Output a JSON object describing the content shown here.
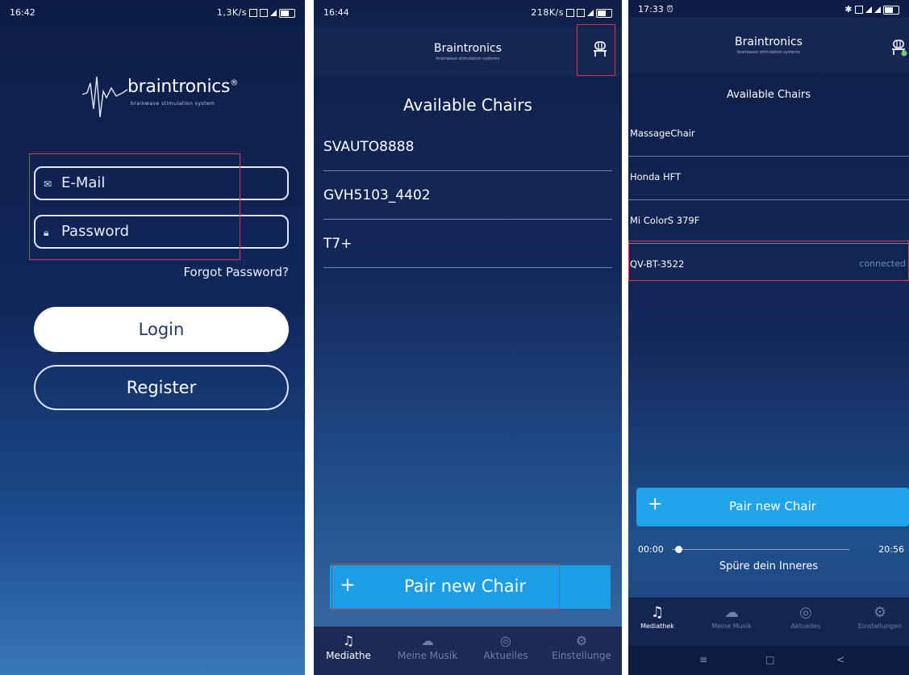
{
  "screen1": {
    "status": {
      "time": "16:42",
      "right": "1,3K/s"
    },
    "logo": {
      "name": "braintronics",
      "trademark": "®",
      "tagline": "brainwave stimulation system"
    },
    "email_placeholder": "E-Mail",
    "password_placeholder": "Password",
    "forgot": "Forgot Password?",
    "login": "Login",
    "register": "Register",
    "highlight_color": "#d23a48"
  },
  "screen2": {
    "status": {
      "time": "16:44",
      "right": "218K/s"
    },
    "header": {
      "brand": "Braintronics",
      "sub": "brainwave stimulation systems"
    },
    "title": "Available Chairs",
    "chairs": [
      "SVAUTO8888",
      "GVH5103_4402",
      "T7+"
    ],
    "pair_button": {
      "icon": "+",
      "label": "Pair new Chair"
    },
    "nav": [
      "Mediathe",
      "Meine Musik",
      "Aktuelles",
      "Einstellunge"
    ],
    "accent": "#1c9ee6"
  },
  "screen3": {
    "status": {
      "time": "17:33"
    },
    "header": {
      "brand": "Braintronics",
      "sub": "brainwave stimulation systems"
    },
    "title": "Available Chairs",
    "chairs": [
      {
        "name": "MassageChair",
        "status": ""
      },
      {
        "name": "Honda HFT",
        "status": ""
      },
      {
        "name": "Mi ColorS 379F",
        "status": ""
      },
      {
        "name": "QV-BT-3522",
        "status": "connected"
      }
    ],
    "pair_button": {
      "icon": "+",
      "label": "Pair new Chair"
    },
    "player": {
      "elapsed": "00:00",
      "total": "20:56",
      "title": "Spüre dein Inneres",
      "progress": 0.02
    },
    "nav": [
      "Mediathek",
      "Meine Musik",
      "Aktuelles",
      "Einstellungen"
    ],
    "system_nav": [
      "≡",
      "□",
      "<"
    ]
  }
}
